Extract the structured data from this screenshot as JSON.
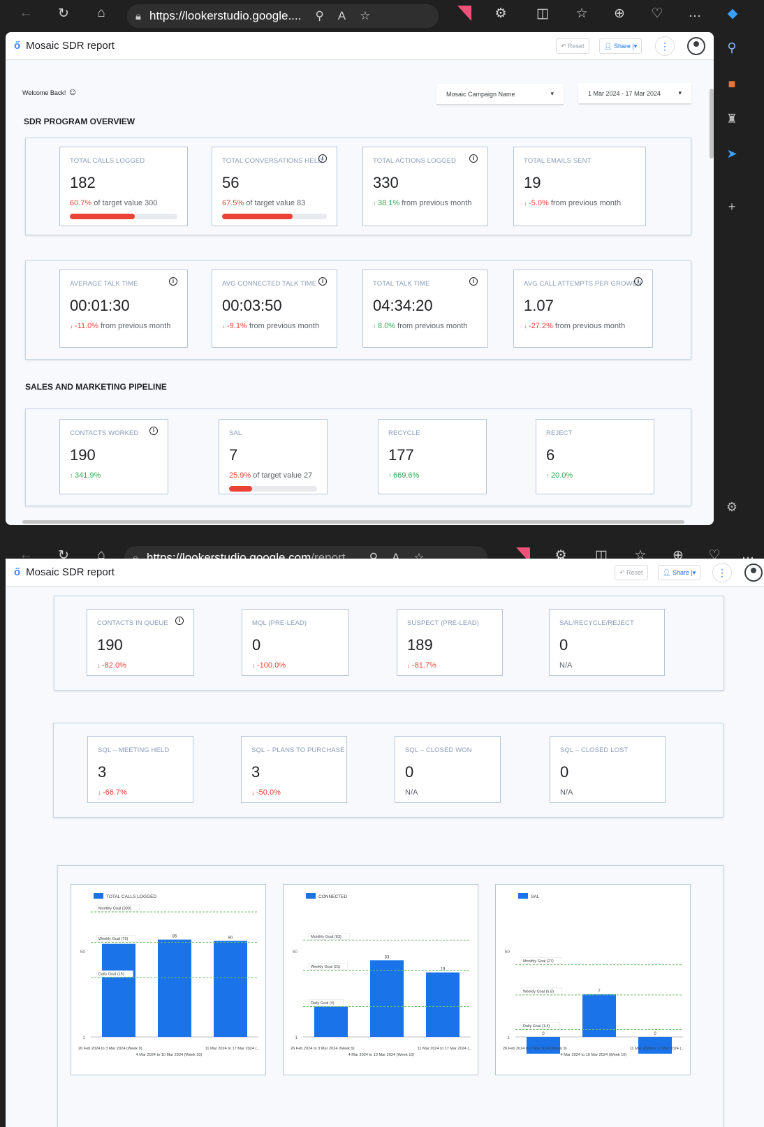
{
  "browser": {
    "top_url_host": "https://lookerstudio.google....",
    "bottom_url_host": "https://lookerstudio.google.com",
    "bottom_url_path": "/report..."
  },
  "app": {
    "logo": "ő",
    "title": "Mosaic SDR report",
    "reset_label": "Reset",
    "share_label": "Share",
    "more_label": "⋮"
  },
  "welcome": "Welcome Back!",
  "filters": {
    "campaign": "Mosaic Campaign Name",
    "date_range": "1 Mar 2024 - 17 Mar 2024"
  },
  "sections": {
    "overview": "SDR PROGRAM OVERVIEW",
    "pipeline": "SALES AND MARKETING PIPELINE"
  },
  "overview_row1": [
    {
      "label": "TOTAL CALLS LOGGED",
      "value": "182",
      "pct": "60.7%",
      "text": " of target value 300",
      "dir": "red",
      "progress": 0.607
    },
    {
      "label": "TOTAL CONVERSATIONS HELD",
      "value": "56",
      "pct": "67.5%",
      "text": " of target value 83",
      "dir": "red",
      "progress": 0.675
    },
    {
      "label": "TOTAL ACTIONS LOGGED",
      "value": "330",
      "pct": "38.1%",
      "text": " from previous month",
      "dir": "green",
      "arrow": "↑"
    },
    {
      "label": "TOTAL EMAILS SENT",
      "value": "19",
      "pct": "-5.0%",
      "text": " from previous month",
      "dir": "red",
      "arrow": "↓"
    }
  ],
  "overview_row2": [
    {
      "label": "AVERAGE TALK TIME",
      "value": "00:01:30",
      "pct": "-11.0%",
      "text": " from previous month",
      "dir": "red",
      "arrow": "↓"
    },
    {
      "label": "AVG CONNECTED TALK TIME",
      "value": "00:03:50",
      "pct": "-9.1%",
      "text": " from previous month",
      "dir": "red",
      "arrow": "↓"
    },
    {
      "label": "TOTAL TALK TIME",
      "value": "04:34:20",
      "pct": "8.0%",
      "text": " from previous month",
      "dir": "green",
      "arrow": "↑"
    },
    {
      "label": "AVG CALL ATTEMPTS PER GROWER",
      "value": "1.07",
      "pct": "-27.2%",
      "text": " from previous month",
      "dir": "red",
      "arrow": "↓"
    }
  ],
  "pipeline_row1": [
    {
      "label": "CONTACTS WORKED",
      "value": "190",
      "pct": "341.9%",
      "dir": "green",
      "arrow": "↑"
    },
    {
      "label": "SAL",
      "value": "7",
      "pct": "25.9%",
      "text": " of target value 27",
      "dir": "red",
      "progress": 0.259
    },
    {
      "label": "RECYCLE",
      "value": "177",
      "pct": "669.6%",
      "dir": "green",
      "arrow": "↑"
    },
    {
      "label": "REJECT",
      "value": "6",
      "pct": "20.0%",
      "dir": "green",
      "arrow": "↑"
    }
  ],
  "pipeline_row2": [
    {
      "label": "CONTACTS  IN QUEUE",
      "value": "190",
      "pct": "-82.0%",
      "dir": "red",
      "arrow": "↓"
    },
    {
      "label": "MQL (Pre-Lead)",
      "value": "0",
      "pct": "-100.0%",
      "dir": "red",
      "arrow": "↓"
    },
    {
      "label": "SUSPECT (Pre-Lead)",
      "value": "189",
      "pct": "-81.7%",
      "dir": "red",
      "arrow": "↓"
    },
    {
      "label": "SAL/RECYCLE/REJECT",
      "value": "0",
      "na": "N/A"
    }
  ],
  "pipeline_row3": [
    {
      "label": "SQL – MEETING HELD",
      "value": "3",
      "pct": "-66.7%",
      "dir": "red",
      "arrow": "↓"
    },
    {
      "label": "SQL – PLANS TO PURCHASE",
      "value": "3",
      "pct": "-50.0%",
      "dir": "red",
      "arrow": "↓"
    },
    {
      "label": "SQL – CLOSED WON",
      "value": "0",
      "na": "N/A"
    },
    {
      "label": "SQL – CLOSED LOST",
      "value": "0",
      "na": "N/A"
    }
  ],
  "colors": {
    "bar": "#1a73e8",
    "goal_line": "#6abf69",
    "negative": "#ea4335",
    "positive": "#34a853"
  },
  "chart_data": [
    {
      "type": "bar",
      "series": [
        {
          "name": "TOTAL CALLS LOGGED",
          "values": [
            70,
            85,
            80
          ]
        }
      ],
      "categories": [
        "26 Feb 2024 to 3 Mar 2024 (Week 9)",
        "4 Mar 2024 to 10 Mar 2024 (Week 10)",
        "11 Mar 2024 to 17 Mar 2024 (..."
      ],
      "data_labels": [
        "70",
        "85",
        "80"
      ],
      "goals": [
        {
          "label": "Monthly Goal (300)",
          "value": 300
        },
        {
          "label": "Weekly Goal (75)",
          "value": 75
        },
        {
          "label": "Daily Goal (15)",
          "value": 15
        }
      ],
      "yticks": [
        "50",
        "1"
      ],
      "scale": "log"
    },
    {
      "type": "bar",
      "series": [
        {
          "name": "CONNECTED",
          "values": [
            4,
            33,
            19
          ]
        }
      ],
      "categories": [
        "26 Feb 2024 to 3 Mar 2024 (Week 9)",
        "4 Mar 2024 to 10 Mar 2024 (Week 10)",
        "11 Mar 2024 to 17 Mar 2024 (..."
      ],
      "data_labels": [
        "",
        "33",
        "19"
      ],
      "goals": [
        {
          "label": "Monthly Goal (83)",
          "value": 83
        },
        {
          "label": "Weekly Goal (21)",
          "value": 21
        },
        {
          "label": "Daily Goal (4)",
          "value": 4
        }
      ],
      "yticks": [
        "50",
        "1"
      ],
      "scale": "log"
    },
    {
      "type": "bar",
      "series": [
        {
          "name": "SAL",
          "values": [
            0,
            7,
            0
          ]
        }
      ],
      "categories": [
        "26 Feb 2024 to 3 Mar 2024 (Week 9)",
        "4 Mar 2024 to 10 Mar 2024 (Week 10)",
        "11 Mar 2024 to 17 Mar 2024 (..."
      ],
      "data_labels": [
        "0",
        "7",
        "0"
      ],
      "goals": [
        {
          "label": "Monthly Goal (27)",
          "value": 27
        },
        {
          "label": "Weekly Goal (6.8)",
          "value": 6.8
        },
        {
          "label": "Daily Goal (1.4)",
          "value": 1.4
        }
      ],
      "yticks": [
        "50",
        "1"
      ],
      "scale": "log"
    }
  ]
}
